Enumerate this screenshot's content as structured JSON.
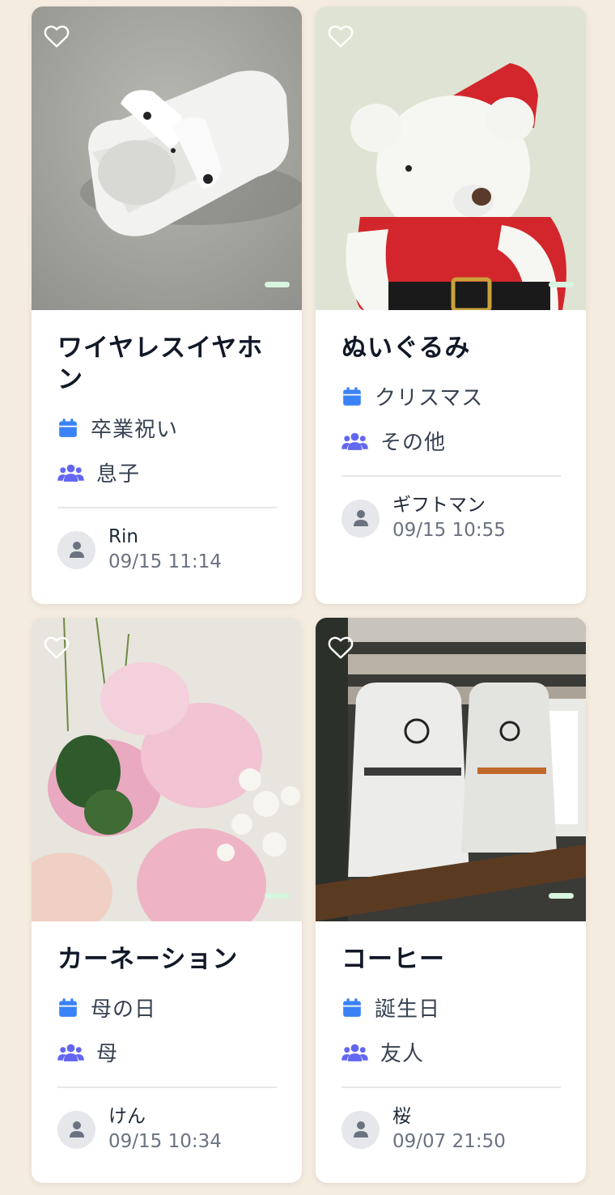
{
  "colors": {
    "page_bg": "#f4ecdf",
    "card_bg": "#ffffff",
    "calendar_icon": "#3b82f6",
    "people_icon": "#6366f1",
    "indicator": "#d7f5df"
  },
  "cards": [
    {
      "title": "ワイヤレスイヤホン",
      "event": "卒業祝い",
      "recipient": "息子",
      "author_name": "Rin",
      "author_date": "09/15 11:14",
      "image": "wireless-earbuds-photo"
    },
    {
      "title": "ぬいぐるみ",
      "event": "クリスマス",
      "recipient": "その他",
      "author_name": "ギフトマン",
      "author_date": "09/15 10:55",
      "image": "teddy-bear-photo"
    },
    {
      "title": "カーネーション",
      "event": "母の日",
      "recipient": "母",
      "author_name": "けん",
      "author_date": "09/15 10:34",
      "image": "pink-flowers-photo"
    },
    {
      "title": "コーヒー",
      "event": "誕生日",
      "recipient": "友人",
      "author_name": "桜",
      "author_date": "09/07 21:50",
      "image": "coffee-bags-photo"
    }
  ],
  "icons": {
    "favorite": "heart-outline-icon",
    "event": "calendar-icon",
    "recipient": "users-icon",
    "avatar": "user-icon"
  }
}
